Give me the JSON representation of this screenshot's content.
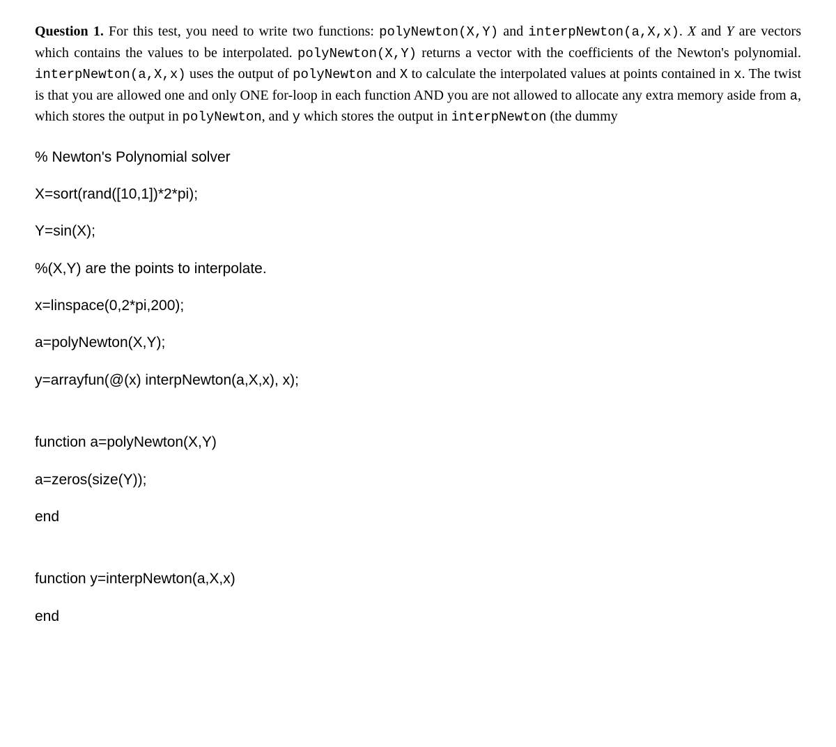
{
  "question": {
    "label": "Question 1.",
    "text_part1": " For this test, you need to write two functions: ",
    "func1": "polyNewton(X,Y)",
    "text_part2": " and ",
    "func2": "interpNewton(a,X,x)",
    "text_part3": ". ",
    "var_x": "X",
    "text_part4": " and ",
    "var_y": "Y",
    "text_part5": " are vectors which contains the values to be interpolated. ",
    "func3": "polyNewton(X,Y)",
    "text_part6": " returns a vector with the coefficients of the Newton's polynomial. ",
    "func4": "interpNewton(a,X,x)",
    "text_part7": " uses the output of ",
    "func5": "polyNewton",
    "text_part8": " and ",
    "var_x2": "X",
    "text_part9": " to calculate the interpolated values at points contained in ",
    "var_lx": "x",
    "text_part10": ". The twist is that you are allowed one and only ONE for-loop in each function AND you are not allowed to allocate any extra memory aside from ",
    "var_a": "a",
    "text_part11": ", which stores the output in ",
    "func6": "polyNewton",
    "text_part12": ", and ",
    "var_ly": "y",
    "text_part13": " which stores the output in ",
    "func7": "interpNewton",
    "text_part14": " (the dummy"
  },
  "code": {
    "line1": "% Newton's Polynomial solver",
    "line2": "X=sort(rand([10,1])*2*pi);",
    "line3": "Y=sin(X);",
    "line4": "%(X,Y) are the points to interpolate.",
    "line5": "x=linspace(0,2*pi,200);",
    "line6": "a=polyNewton(X,Y);",
    "line7": "y=arrayfun(@(x) interpNewton(a,X,x), x);",
    "line8": "function a=polyNewton(X,Y)",
    "line9": "a=zeros(size(Y));",
    "line10": "end",
    "line11": "function y=interpNewton(a,X,x)",
    "line12": "end"
  }
}
